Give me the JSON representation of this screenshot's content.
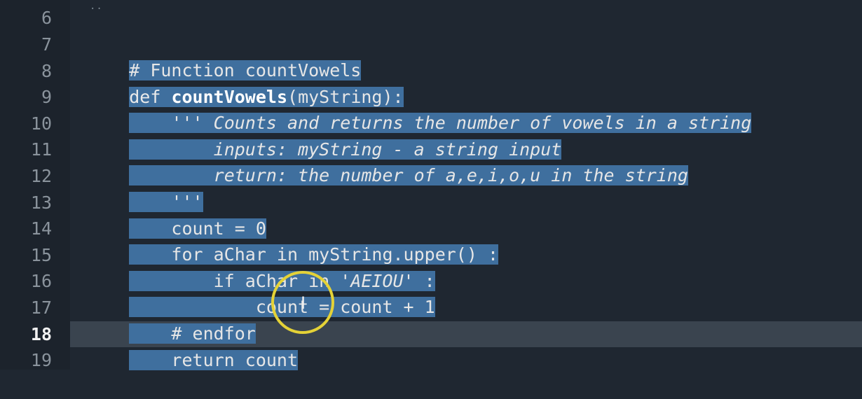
{
  "gutter": {
    "numbers": [
      "6",
      "7",
      "8",
      "9",
      "10",
      "11",
      "12",
      "13",
      "14",
      "15",
      "16",
      "17",
      "18",
      "19"
    ]
  },
  "fold_marker": "..",
  "code": {
    "l7": "# Function countVowels",
    "l8_def": "def ",
    "l8_name": "countVowels",
    "l8_rest": "(myString):",
    "l9_indent": "    ",
    "l9_text": "''' Counts and returns the number of vowels in a string",
    "l10_indent": "        ",
    "l10_text": "inputs: myString - a string input",
    "l11_indent": "        ",
    "l11_text": "return: the number of a,e,i,o,u in the string",
    "l12_indent": "    ",
    "l12_text": "'''",
    "l13": "    count = 0",
    "l14": "    for aChar in myString.upper() :",
    "l15_a": "        if aChar in ",
    "l15_str": "'AEIOU'",
    "l15_b": " :",
    "l16": "            count = count + 1",
    "l17": "    # endfor",
    "l18": "    return count"
  },
  "mouse_cursor": "I"
}
